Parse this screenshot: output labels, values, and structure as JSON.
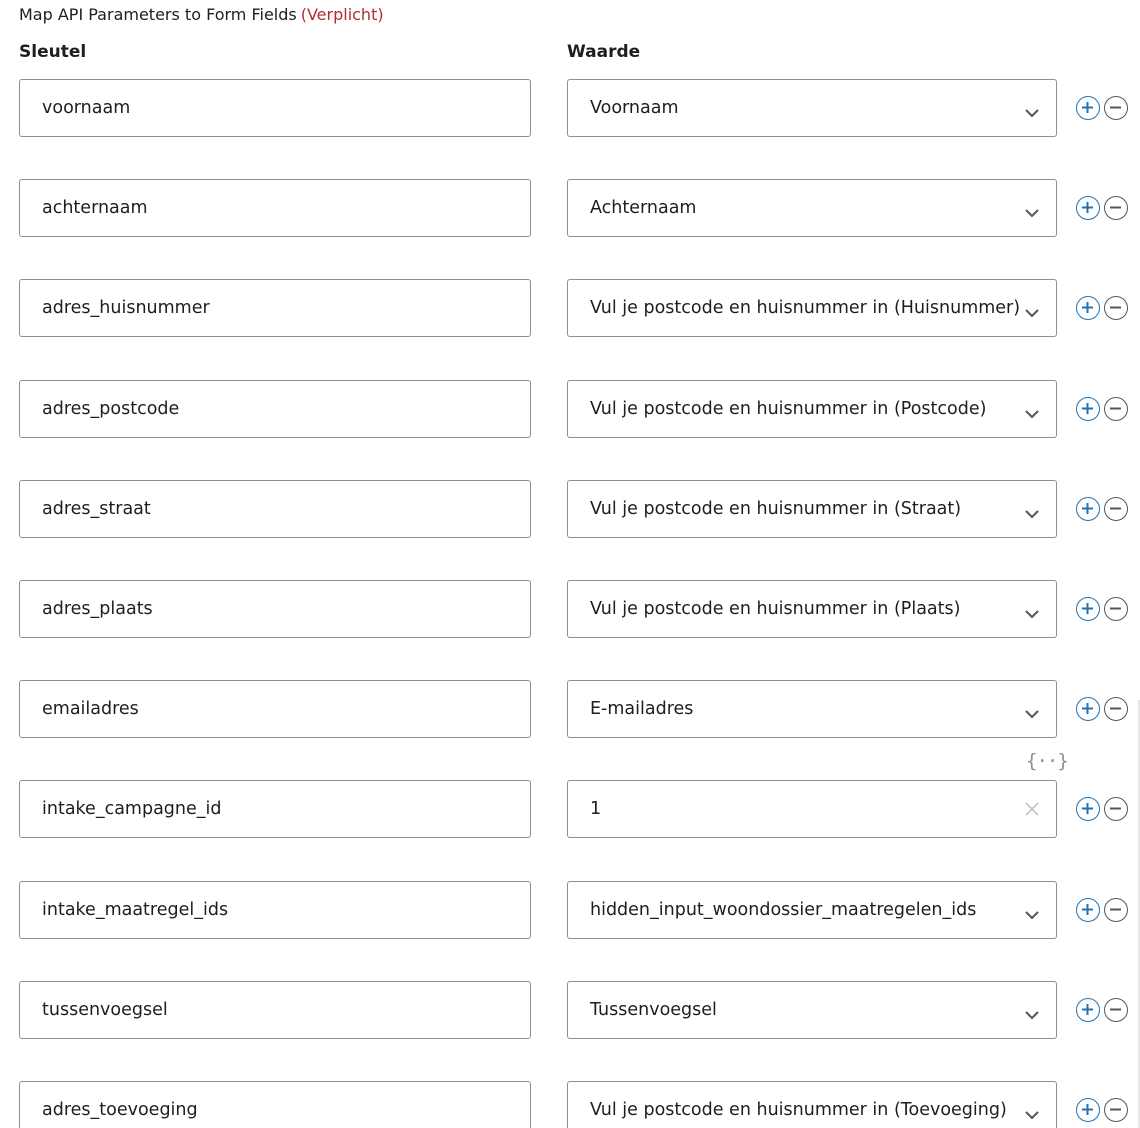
{
  "header": {
    "title": "Map API Parameters to Form Fields",
    "required": "(Verplicht)"
  },
  "columns": {
    "key": "Sleutel",
    "value": "Waarde"
  },
  "rows": [
    {
      "key": "voornaam",
      "value": "Voornaam",
      "type": "select"
    },
    {
      "key": "achternaam",
      "value": "Achternaam",
      "type": "select"
    },
    {
      "key": "adres_huisnummer",
      "value": "Vul je postcode en huisnummer in (Huisnummer)",
      "type": "select"
    },
    {
      "key": "adres_postcode",
      "value": "Vul je postcode en huisnummer in (Postcode)",
      "type": "select"
    },
    {
      "key": "adres_straat",
      "value": "Vul je postcode en huisnummer in (Straat)",
      "type": "select"
    },
    {
      "key": "adres_plaats",
      "value": "Vul je postcode en huisnummer in (Plaats)",
      "type": "select"
    },
    {
      "key": "emailadres",
      "value": "E-mailadres",
      "type": "select"
    },
    {
      "key": "intake_campagne_id",
      "value": "1",
      "type": "text"
    },
    {
      "key": "intake_maatregel_ids",
      "value": "hidden_input_woondossier_maatregelen_ids",
      "type": "select"
    },
    {
      "key": "tussenvoegsel",
      "value": "Tussenvoegsel",
      "type": "select"
    },
    {
      "key": "adres_toevoeging",
      "value": "Vul je postcode en huisnummer in (Toevoeging)",
      "type": "select"
    }
  ],
  "icons": {
    "dropdown": "chevron-down-icon",
    "clear": "close-icon",
    "variables": "variables-icon",
    "add": "plus-icon",
    "remove": "minus-icon",
    "variables_glyph": "{··}"
  },
  "colors": {
    "required": "#b32d2e",
    "border": "#8c8f94",
    "add_button": "#2271b1",
    "remove_button": "#50575e"
  }
}
